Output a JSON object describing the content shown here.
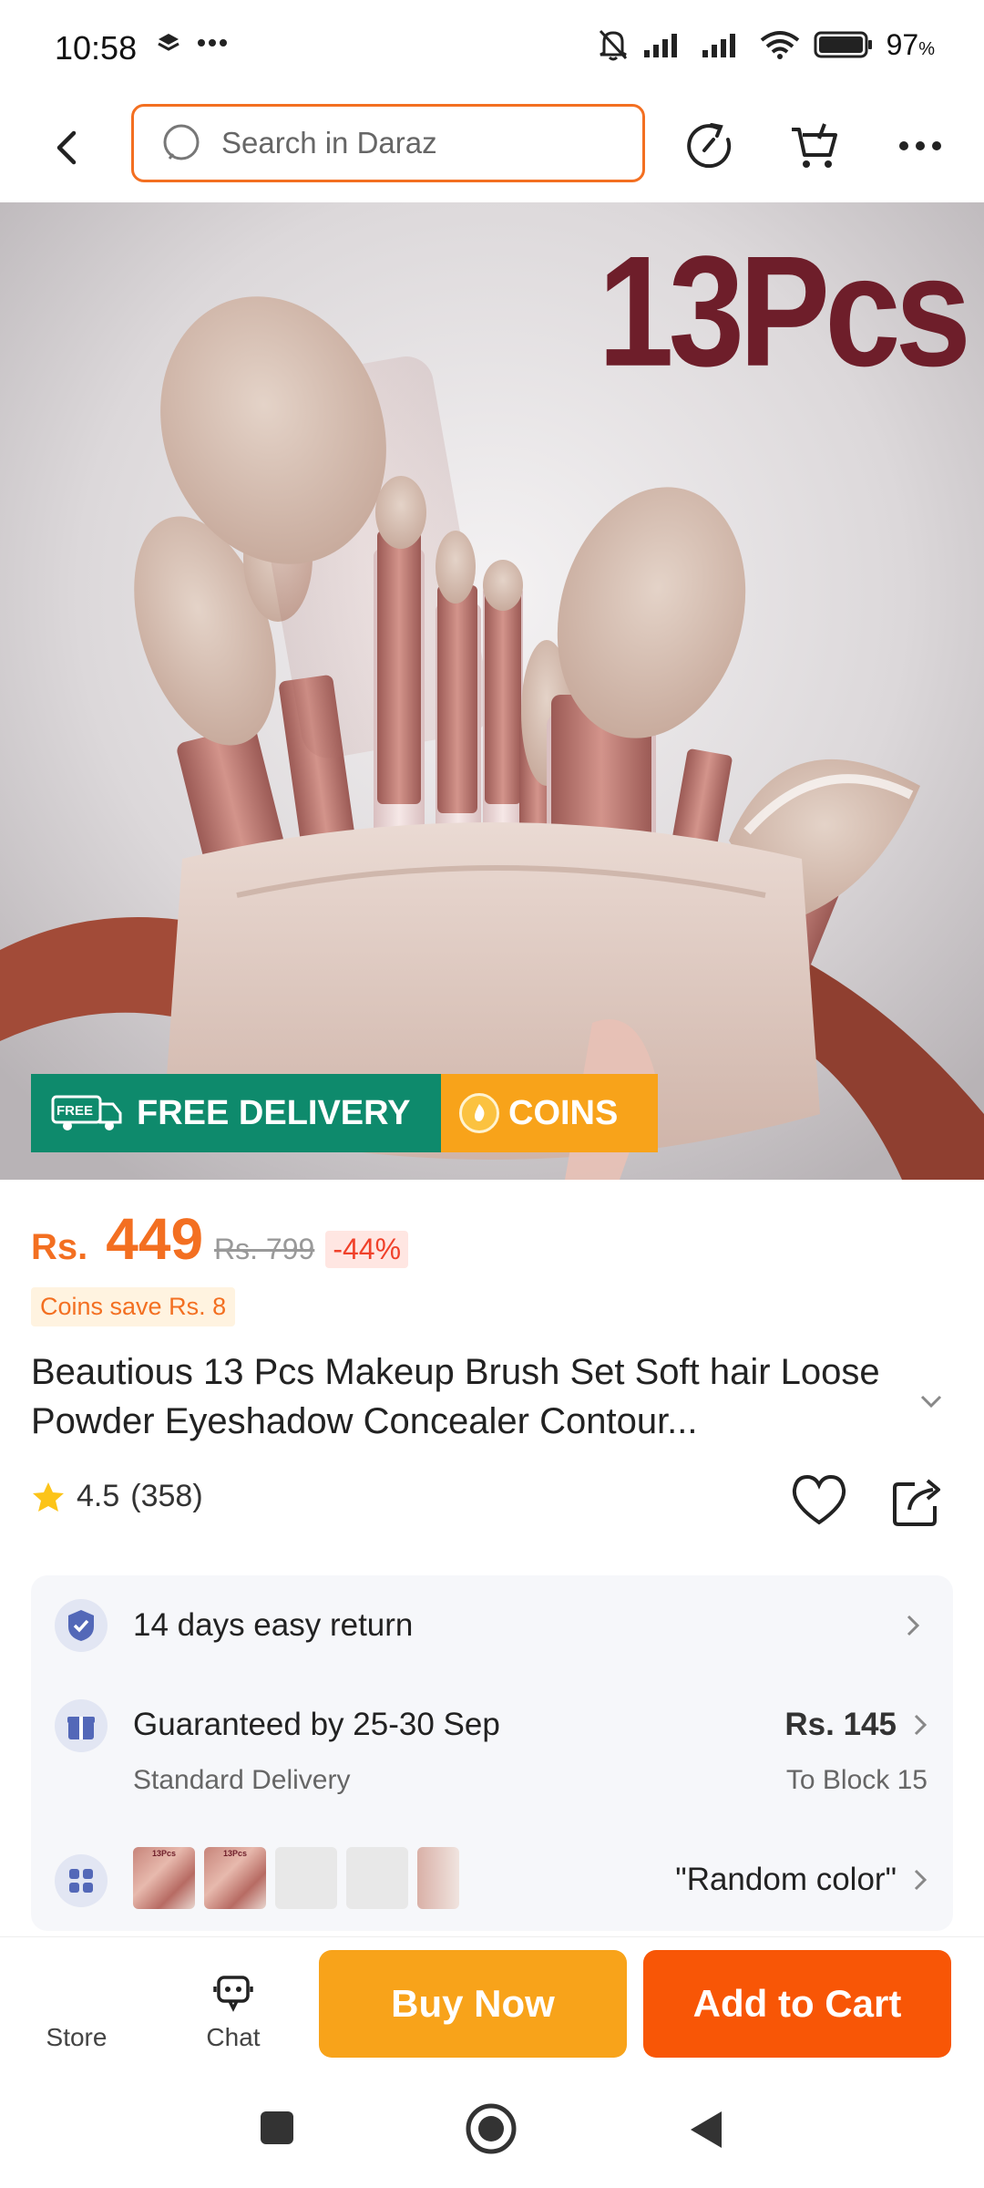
{
  "status_bar": {
    "time": "10:58",
    "battery": "97",
    "battery_unit": "%"
  },
  "top_nav": {
    "search_placeholder": "Search in Daraz"
  },
  "product_image": {
    "overlay_text": "13Pcs",
    "free_delivery_tag": "FREE",
    "free_delivery_label": "FREE DELIVERY",
    "coins_label": "COINS"
  },
  "price": {
    "currency": "Rs.",
    "current": "449",
    "original": "Rs. 799",
    "discount": "-44%",
    "coins_save": "Coins save Rs. 8"
  },
  "product": {
    "title": "Beautious 13 Pcs Makeup Brush Set Soft hair Loose Powder Eyeshadow Concealer Contour...",
    "rating": "4.5",
    "review_count": "(358)"
  },
  "info": {
    "return_text": "14 days easy return",
    "delivery_title": "Guaranteed by 25-30 Sep",
    "delivery_type": "Standard Delivery",
    "delivery_price": "Rs. 145",
    "delivery_to": "To Block 15",
    "thumb_labels": [
      "13Pcs",
      "13Pcs"
    ],
    "variant_text": "\"Random color\""
  },
  "bottom_bar": {
    "store_label": "Store",
    "chat_label": "Chat",
    "buy_now_label": "Buy Now",
    "add_to_cart_label": "Add to Cart"
  },
  "colors": {
    "brand_orange": "#f85606",
    "buy_now": "#f8a31a",
    "free_delivery_green": "#0e8a6c"
  }
}
